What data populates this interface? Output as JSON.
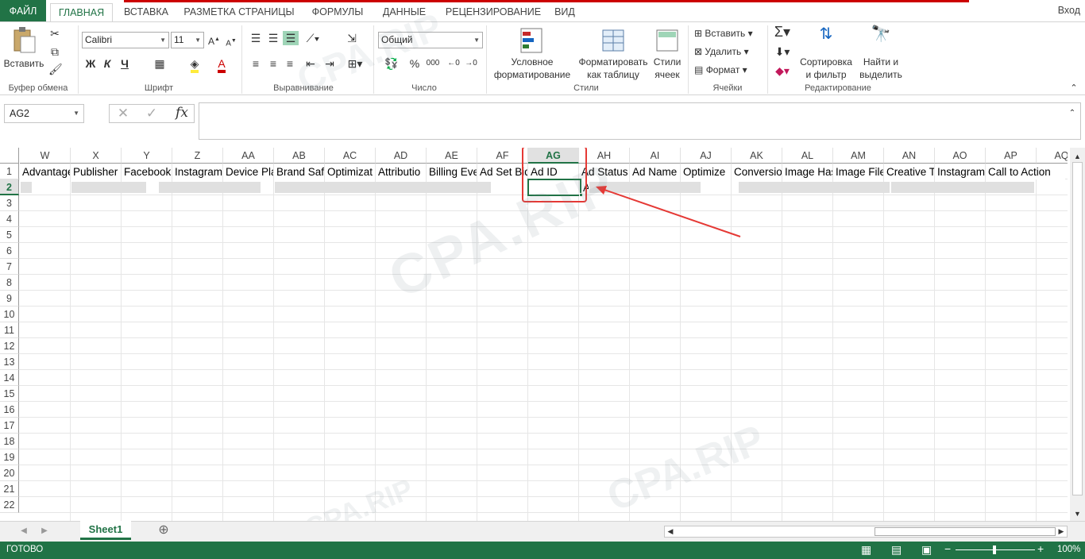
{
  "tabs": [
    "ФАЙЛ",
    "ГЛАВНАЯ",
    "ВСТАВКА",
    "РАЗМЕТКА СТРАНИЦЫ",
    "ФОРМУЛЫ",
    "ДАННЫЕ",
    "РЕЦЕНЗИРОВАНИЕ",
    "ВИД"
  ],
  "login": "Вход",
  "ribbon": {
    "paste": "Вставить",
    "font_name": "Calibri",
    "font_size": "11",
    "bold": "Ж",
    "italic": "К",
    "underline": "Ч",
    "number_format": "Общий",
    "percent": "%",
    "thousands": "000",
    "cond_format_1": "Условное",
    "cond_format_2": "форматирование",
    "format_table_1": "Форматировать",
    "format_table_2": "как таблицу",
    "cell_styles_1": "Стили",
    "cell_styles_2": "ячеек",
    "insert": "Вставить",
    "delete": "Удалить",
    "format": "Формат",
    "sort_1": "Сортировка",
    "sort_2": "и фильтр",
    "find_1": "Найти и",
    "find_2": "выделить",
    "groups": [
      "Буфер обмена",
      "Шрифт",
      "Выравнивание",
      "Число",
      "Стили",
      "Ячейки",
      "Редактирование"
    ]
  },
  "name_box": "AG2",
  "fx": "fx",
  "columns": [
    "W",
    "X",
    "Y",
    "Z",
    "AA",
    "AB",
    "AC",
    "AD",
    "AE",
    "AF",
    "AG",
    "AH",
    "AI",
    "AJ",
    "AK",
    "AL",
    "AM",
    "AN",
    "AO",
    "AP",
    "AQ"
  ],
  "selected_column": "AG",
  "rows": [
    "1",
    "2",
    "3",
    "4",
    "5",
    "6",
    "7",
    "8",
    "9",
    "10",
    "11",
    "12",
    "13",
    "14",
    "15",
    "16",
    "17",
    "18",
    "19",
    "20",
    "21",
    "22"
  ],
  "header_cells": [
    "Advantage",
    "Publisher",
    "Facebook",
    "Instagram",
    "Device Pla",
    "Brand Safe",
    "Optimizat",
    "Attributio",
    "Billing Eve",
    "Ad Set Bid",
    "Ad ID",
    "Ad Status",
    "Ad Name",
    "Optimize",
    "Conversio",
    "Image Has",
    "Image File",
    "Creative T",
    "Instagram",
    "Call to Action",
    ""
  ],
  "row2_partial": "A",
  "sheet": "Sheet1",
  "status": "ГОТОВО",
  "zoom": "100%",
  "watermark": "CPA.RIP",
  "colors": {
    "accent": "#217346",
    "highlight": "#e53935"
  }
}
